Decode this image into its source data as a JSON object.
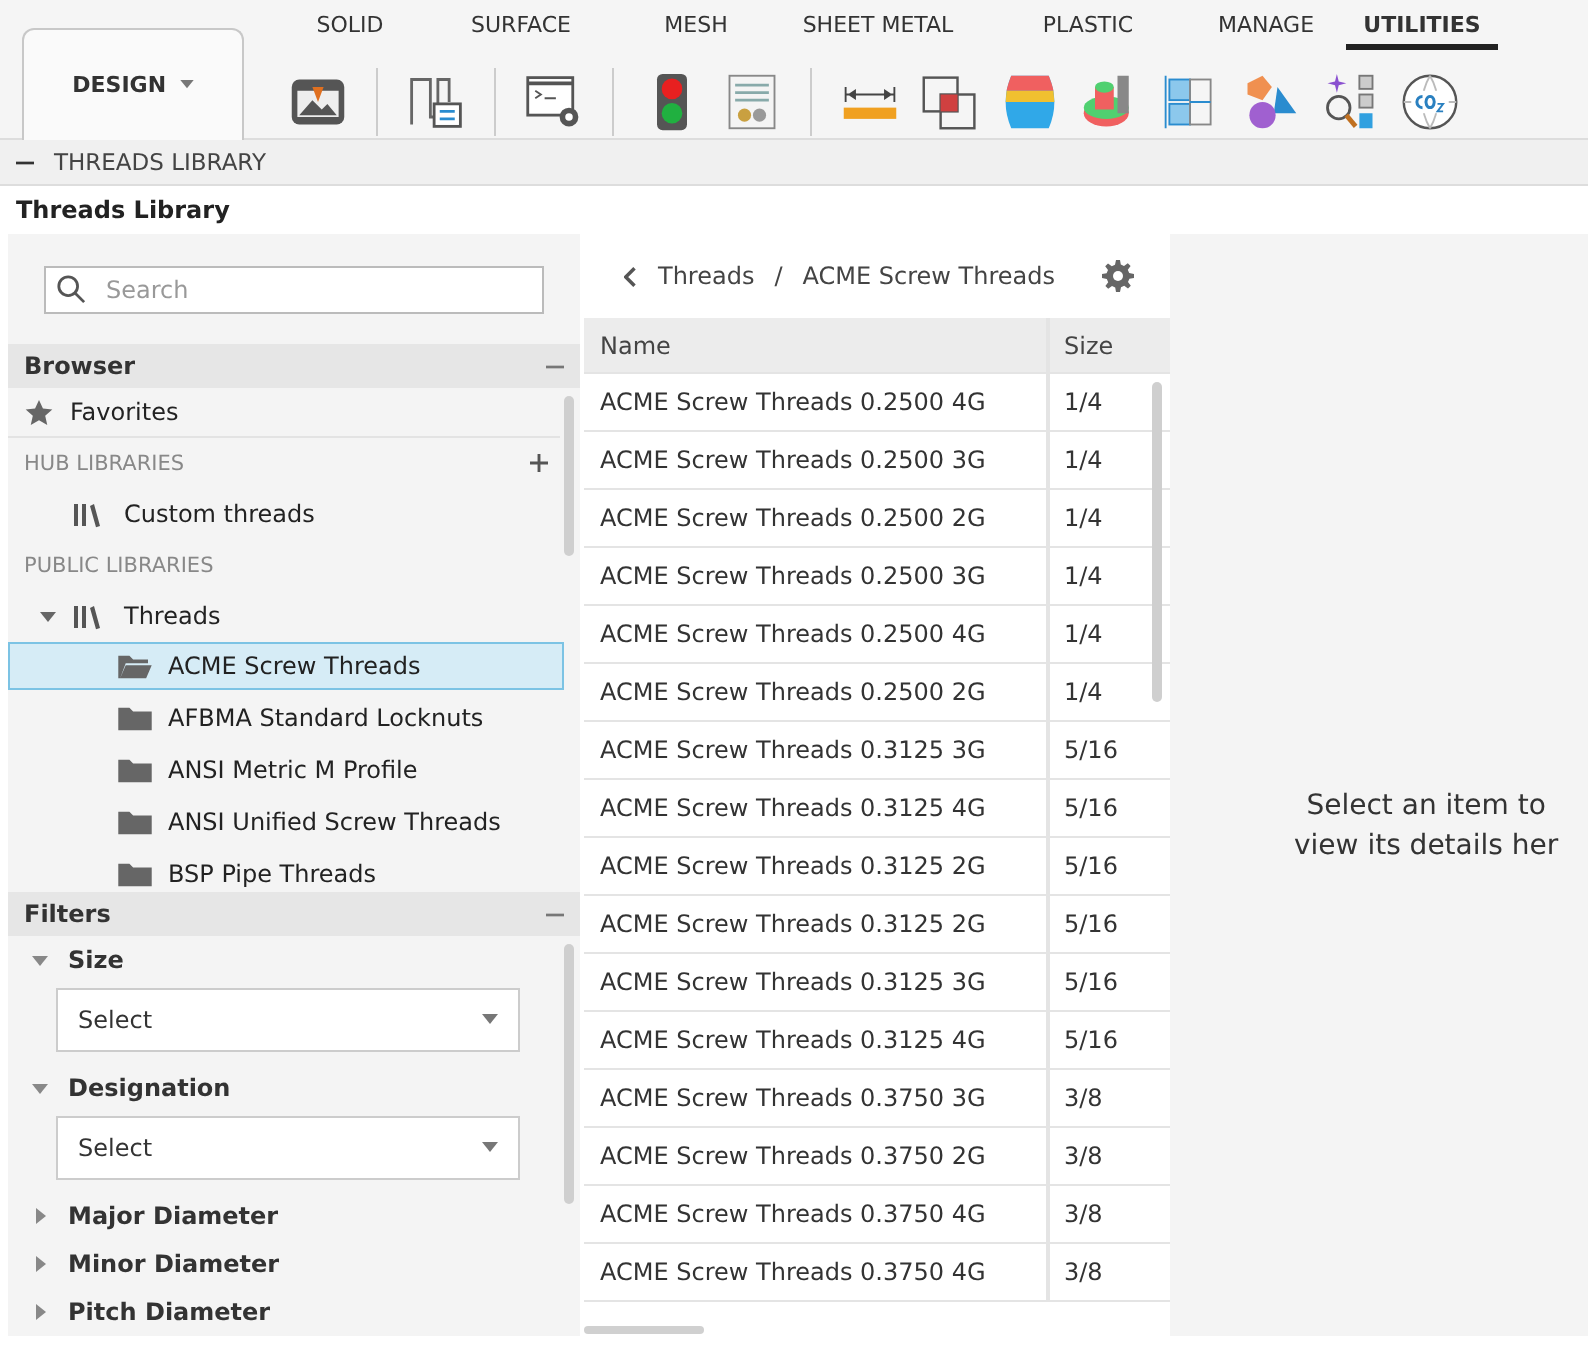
{
  "ribbon": {
    "workspace": "DESIGN",
    "tabs": [
      {
        "label": "SOLID",
        "selected": false
      },
      {
        "label": "SURFACE",
        "selected": false
      },
      {
        "label": "MESH",
        "selected": false
      },
      {
        "label": "SHEET METAL",
        "selected": false
      },
      {
        "label": "PLASTIC",
        "selected": false
      },
      {
        "label": "MANAGE",
        "selected": false
      },
      {
        "label": "UTILITIES",
        "selected": true
      }
    ]
  },
  "panel": {
    "header": "THREADS LIBRARY",
    "title": "Threads Library"
  },
  "search": {
    "placeholder": "Search"
  },
  "browser": {
    "title": "Browser",
    "favorites": "Favorites",
    "sections": [
      {
        "label": "HUB LIBRARIES",
        "addable": true,
        "libraries": [
          {
            "label": "Custom threads"
          }
        ]
      },
      {
        "label": "PUBLIC LIBRARIES",
        "addable": false,
        "libraries": [
          {
            "label": "Threads",
            "expanded": true,
            "children": [
              {
                "label": "ACME Screw Threads",
                "selected": true
              },
              {
                "label": "AFBMA Standard Locknuts",
                "selected": false
              },
              {
                "label": "ANSI Metric M Profile",
                "selected": false
              },
              {
                "label": "ANSI Unified Screw Threads",
                "selected": false
              },
              {
                "label": "BSP Pipe Threads",
                "selected": false
              }
            ]
          }
        ]
      }
    ]
  },
  "filters": {
    "title": "Filters",
    "items": [
      {
        "label": "Size",
        "expanded": true,
        "placeholder": "Select"
      },
      {
        "label": "Designation",
        "expanded": true,
        "placeholder": "Select"
      },
      {
        "label": "Major Diameter",
        "expanded": false
      },
      {
        "label": "Minor Diameter",
        "expanded": false
      },
      {
        "label": "Pitch Diameter",
        "expanded": false
      }
    ]
  },
  "breadcrumb": [
    "Threads",
    "ACME Screw Threads"
  ],
  "breadcrumb_separator": "/",
  "table": {
    "columns": [
      "Name",
      "Size"
    ],
    "rows": [
      [
        "ACME Screw Threads 0.2500 4G",
        "1/4"
      ],
      [
        "ACME Screw Threads 0.2500 3G",
        "1/4"
      ],
      [
        "ACME Screw Threads 0.2500 2G",
        "1/4"
      ],
      [
        "ACME Screw Threads 0.2500 3G",
        "1/4"
      ],
      [
        "ACME Screw Threads 0.2500 4G",
        "1/4"
      ],
      [
        "ACME Screw Threads 0.2500 2G",
        "1/4"
      ],
      [
        "ACME Screw Threads 0.3125 3G",
        "5/16"
      ],
      [
        "ACME Screw Threads 0.3125 4G",
        "5/16"
      ],
      [
        "ACME Screw Threads 0.3125 2G",
        "5/16"
      ],
      [
        "ACME Screw Threads 0.3125 2G",
        "5/16"
      ],
      [
        "ACME Screw Threads 0.3125 3G",
        "5/16"
      ],
      [
        "ACME Screw Threads 0.3125 4G",
        "5/16"
      ],
      [
        "ACME Screw Threads 0.3750 3G",
        "3/8"
      ],
      [
        "ACME Screw Threads 0.3750 2G",
        "3/8"
      ],
      [
        "ACME Screw Threads 0.3750 4G",
        "3/8"
      ],
      [
        "ACME Screw Threads 0.3750 4G",
        "3/8"
      ]
    ]
  },
  "details": {
    "lines": [
      "Select an item to",
      "view its details her"
    ]
  }
}
